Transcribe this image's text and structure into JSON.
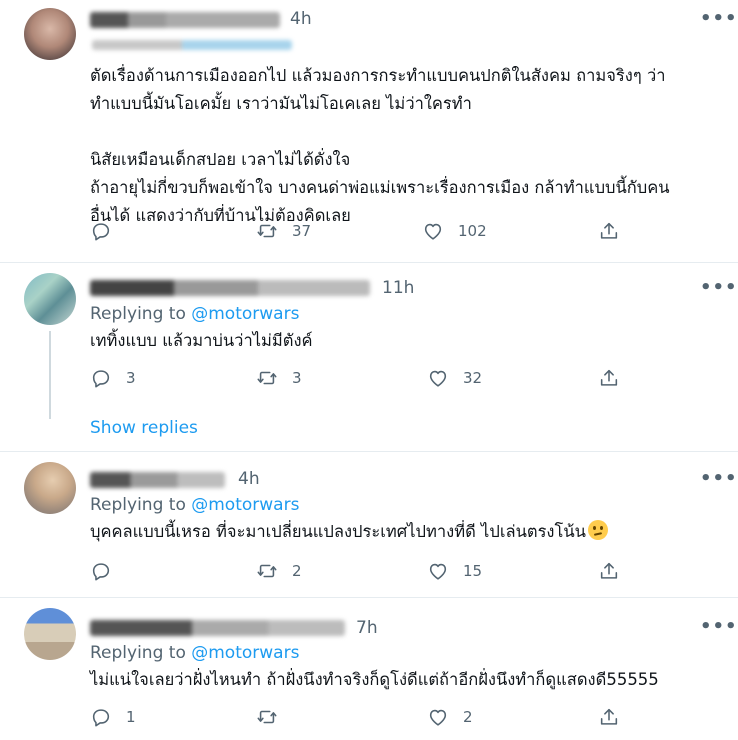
{
  "colors": {
    "accent": "#1d9bf0",
    "secondary_text": "#536471",
    "divider": "#e6ecf0"
  },
  "tweets": [
    {
      "time": "4h",
      "more": "•••",
      "text": "ตัดเรื่องด้านการเมืองออกไป แล้วมองการกระทำแบบคนปกติในสังคม ถามจริงๆ ว่า\nทำแบบนี้มันโอเคมั้ย เราว่ามันไม่โอเคเลย ไม่ว่าใครทำ\n\nนิสัยเหมือนเด็กสปอย เวลาไม่ได้ดั่งใจ\nถ้าอายุไม่กี่ขวบก็พอเข้าใจ บางคนด่าพ่อแม่เพราะเรื่องการเมือง กล้าทำแบบนี้กับคน\nอื่นได้ แสดงว่ากับที่บ้านไม่ต้องคิดเลย",
      "reply_count": "",
      "retweet_count": "37",
      "like_count": "102",
      "icons": [
        "reply-icon",
        "retweet-icon",
        "heart-icon",
        "share-icon"
      ]
    },
    {
      "time": "11h",
      "more": "•••",
      "replying_label": "Replying to",
      "replying_handle": "@motorwars",
      "text": "เททิ้งแบบ แล้วมาบ่นว่าไม่มีตังค์",
      "reply_count": "3",
      "retweet_count": "3",
      "like_count": "32",
      "show_replies": "Show replies"
    },
    {
      "time": "4h",
      "more": "•••",
      "replying_label": "Replying to",
      "replying_handle": "@motorwars",
      "text": "บุคคลแบบนี้เหรอ ที่จะมาเปลี่ยนแปลงประเทศไปทางที่ดี ไปเล่นตรงโน้น",
      "emoji": "face-with-rolling-eyes",
      "reply_count": "",
      "retweet_count": "2",
      "like_count": "15"
    },
    {
      "time": "7h",
      "more": "•••",
      "replying_label": "Replying to",
      "replying_handle": "@motorwars",
      "text": "ไม่แน่ใจเลยว่าฝั่งไหนทำ ถ้าฝั่งนึงทำจริงก็ดูโง่ดีแต่ถ้าอีกฝั่งนึงทำก็ดูแสดงดี55555",
      "reply_count": "1",
      "retweet_count": "",
      "like_count": "2"
    }
  ]
}
